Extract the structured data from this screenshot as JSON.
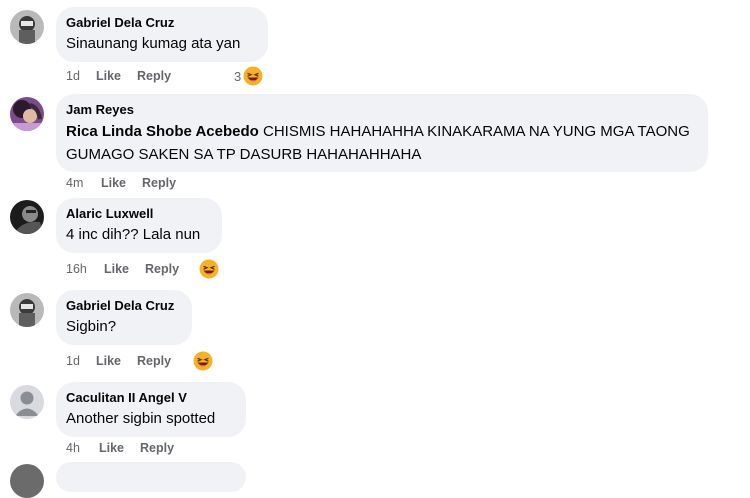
{
  "comments": [
    {
      "author": "Gabriel Dela Cruz",
      "mention": "",
      "text": "Sinaunang kumag ata yan",
      "time": "1d",
      "like": "Like",
      "reply": "Reply",
      "reaction_count": "3",
      "reaction_icon": "haha-emoji-icon"
    },
    {
      "author": "Jam Reyes",
      "mention": "Rica Linda Shobe Acebedo",
      "text": " CHISMIS HAHAHAHHA KINAKARAMA NA YUNG MGA TAONG GUMAGO SAKEN SA TP DASURB HAHAHAHHAHA",
      "time": "4m",
      "like": "Like",
      "reply": "Reply",
      "reaction_count": "",
      "reaction_icon": ""
    },
    {
      "author": "Alaric Luxwell",
      "mention": "",
      "text": "4 inc dih?? Lala nun",
      "time": "16h",
      "like": "Like",
      "reply": "Reply",
      "reaction_count": "",
      "reaction_icon": "haha-emoji-icon"
    },
    {
      "author": "Gabriel Dela Cruz",
      "mention": "",
      "text": "Sigbin?",
      "time": "1d",
      "like": "Like",
      "reply": "Reply",
      "reaction_count": "",
      "reaction_icon": "haha-emoji-icon"
    },
    {
      "author": "Caculitan II Angel V",
      "mention": "",
      "text": "Another sigbin spotted",
      "time": "4h",
      "like": "Like",
      "reply": "Reply",
      "reaction_count": "",
      "reaction_icon": ""
    }
  ],
  "colors": {
    "bubble": "#f0f2f5",
    "meta": "#65676b",
    "text": "#050505",
    "emoji_face": "#f7b125",
    "emoji_mouth": "#7a1b0f"
  }
}
